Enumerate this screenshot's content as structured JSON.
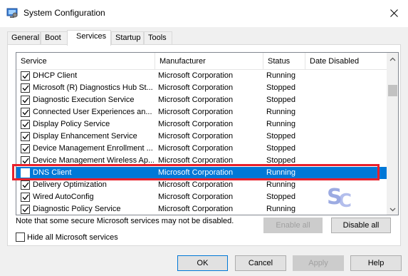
{
  "window": {
    "title": "System Configuration",
    "app_icon": "system-configuration-icon",
    "close_icon": "close-icon"
  },
  "tabs": [
    {
      "label": "General",
      "active": false
    },
    {
      "label": "Boot",
      "active": false
    },
    {
      "label": "Services",
      "active": true
    },
    {
      "label": "Startup",
      "active": false
    },
    {
      "label": "Tools",
      "active": false
    }
  ],
  "table": {
    "columns": [
      "Service",
      "Manufacturer",
      "Status",
      "Date Disabled"
    ],
    "rows": [
      {
        "service": "DHCP Client",
        "manufacturer": "Microsoft Corporation",
        "status": "Running",
        "date_disabled": "",
        "checked": true,
        "selected": false
      },
      {
        "service": "Microsoft (R) Diagnostics Hub St...",
        "manufacturer": "Microsoft Corporation",
        "status": "Stopped",
        "date_disabled": "",
        "checked": true,
        "selected": false
      },
      {
        "service": "Diagnostic Execution Service",
        "manufacturer": "Microsoft Corporation",
        "status": "Stopped",
        "date_disabled": "",
        "checked": true,
        "selected": false
      },
      {
        "service": "Connected User Experiences an...",
        "manufacturer": "Microsoft Corporation",
        "status": "Running",
        "date_disabled": "",
        "checked": true,
        "selected": false
      },
      {
        "service": "Display Policy Service",
        "manufacturer": "Microsoft Corporation",
        "status": "Running",
        "date_disabled": "",
        "checked": true,
        "selected": false
      },
      {
        "service": "Display Enhancement Service",
        "manufacturer": "Microsoft Corporation",
        "status": "Stopped",
        "date_disabled": "",
        "checked": true,
        "selected": false
      },
      {
        "service": "Device Management Enrollment ...",
        "manufacturer": "Microsoft Corporation",
        "status": "Stopped",
        "date_disabled": "",
        "checked": true,
        "selected": false
      },
      {
        "service": "Device Management Wireless Ap...",
        "manufacturer": "Microsoft Corporation",
        "status": "Stopped",
        "date_disabled": "",
        "checked": true,
        "selected": false
      },
      {
        "service": "DNS Client",
        "manufacturer": "Microsoft Corporation",
        "status": "Running",
        "date_disabled": "",
        "checked": true,
        "selected": true
      },
      {
        "service": "Delivery Optimization",
        "manufacturer": "Microsoft Corporation",
        "status": "Running",
        "date_disabled": "",
        "checked": true,
        "selected": false
      },
      {
        "service": "Wired AutoConfig",
        "manufacturer": "Microsoft Corporation",
        "status": "Stopped",
        "date_disabled": "",
        "checked": true,
        "selected": false
      },
      {
        "service": "Diagnostic Policy Service",
        "manufacturer": "Microsoft Corporation",
        "status": "Running",
        "date_disabled": "",
        "checked": true,
        "selected": false
      }
    ]
  },
  "note": "Note that some secure Microsoft services may not be disabled.",
  "enable_all": "Enable all",
  "disable_all": "Disable all",
  "hide_ms_label": "Hide all Microsoft services",
  "hide_ms_checked": false,
  "buttons": {
    "ok": "OK",
    "cancel": "Cancel",
    "apply": "Apply",
    "help": "Help"
  },
  "colors": {
    "selection": "#0078d7",
    "highlight_border": "#e8202a",
    "watermark": "#7b8fd9"
  }
}
